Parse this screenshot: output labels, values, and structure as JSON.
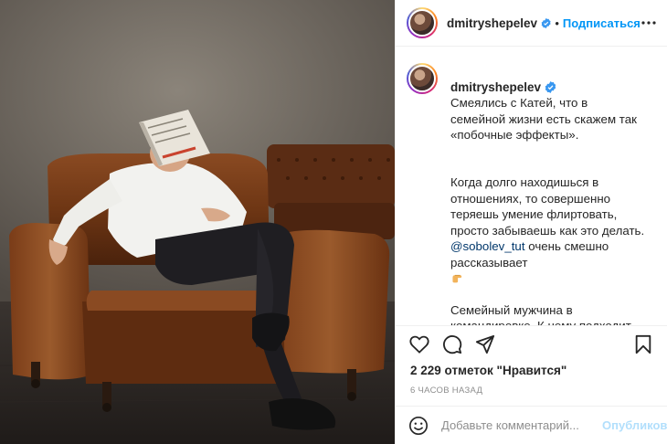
{
  "header": {
    "username": "dmitryshepelev",
    "separator": "•",
    "follow_label": "Подписаться"
  },
  "caption": {
    "username": "dmitryshepelev",
    "p1": "Смеялись с Катей, что в семейной жизни есть скажем так «побочные эффекты».",
    "p2_before": "Когда долго находишься в отношениях, то совершенно теряешь умение флиртовать, просто забываешь как это делать.",
    "p2_mention": "@sobolev_tut",
    "p2_after": " очень смешно рассказывает",
    "p3": "Семейный мужчина в командировке. К нему подходит незнакомая красивая девушка.\nДевушка: что вы делаете сегодня вечером?\nМужчина: пью шампанское с тобой (должен был бы ответить он, но отвечает)...созваниваюсь с детьми по Скайпу."
  },
  "actions": {
    "like_icon": "heart-icon",
    "comment_icon": "comment-icon",
    "share_icon": "share-icon",
    "save_icon": "bookmark-icon"
  },
  "likes_text": "2 229 отметок \"Нравится\"",
  "time_ago": "6 часов назад",
  "comment_box": {
    "emoji_icon": "smiley-icon",
    "placeholder": "Добавьте комментарий...",
    "publish_label": "Опубликовать"
  },
  "colors": {
    "accent": "#0095f6",
    "publish_disabled": "#b2dffc",
    "verified": "#3897f0"
  }
}
